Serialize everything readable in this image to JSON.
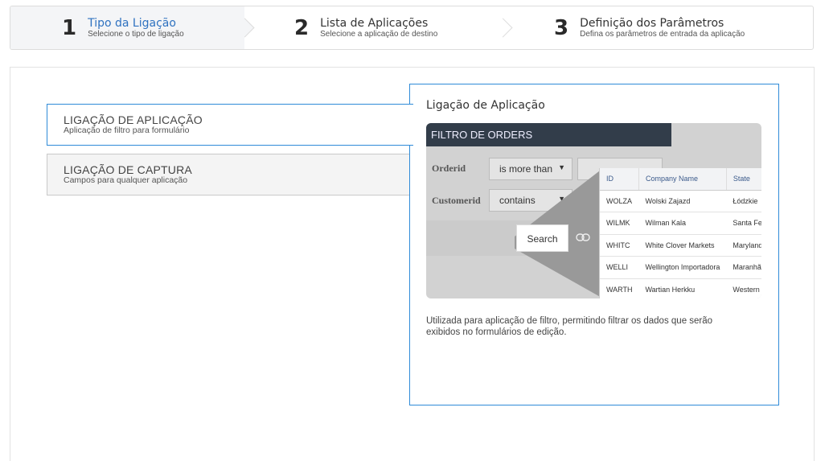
{
  "wizard": {
    "steps": [
      {
        "number": "1",
        "title": "Tipo da Ligação",
        "subtitle": "Selecione o tipo de ligação"
      },
      {
        "number": "2",
        "title": "Lista de Aplicações",
        "subtitle": "Selecione a aplicação de destino"
      },
      {
        "number": "3",
        "title": "Definição dos Parâmetros",
        "subtitle": "Defina os parâmetros de entrada da aplicação"
      }
    ],
    "active_color": "#2f72c0"
  },
  "options": [
    {
      "name": "LIGAÇÃO DE APLICAÇÃO",
      "description": "Aplicação de filtro para formulário"
    },
    {
      "name": "LIGAÇÃO DE CAPTURA",
      "description": "Campos para qualquer aplicação"
    }
  ],
  "panel": {
    "title": "Ligação de Aplicação",
    "description": "Utilizada para aplicação de filtro, permitindo filtrar os dados que serão exibidos no formulários de edição.",
    "border_color": "#2f8bd8"
  },
  "preview": {
    "header": "FILTRO DE ORDERS",
    "rows": [
      {
        "label": "Orderid",
        "operator": "is more than"
      },
      {
        "label": "Customerid",
        "operator": "contains"
      }
    ],
    "search_label": "Search",
    "link_icon": "link-icon",
    "table": {
      "columns": [
        "ID",
        "Company Name",
        "State"
      ],
      "rows": [
        [
          "WOLZA",
          "Wolski Zajazd",
          "Łódzkie"
        ],
        [
          "WILMK",
          "Wilman Kala",
          "Santa Fe"
        ],
        [
          "WHITC",
          "White Clover Markets",
          "Maryland"
        ],
        [
          "WELLI",
          "Wellington Importadora",
          "Maranhão"
        ],
        [
          "WARTH",
          "Wartian Herkku",
          "Western"
        ]
      ]
    }
  }
}
